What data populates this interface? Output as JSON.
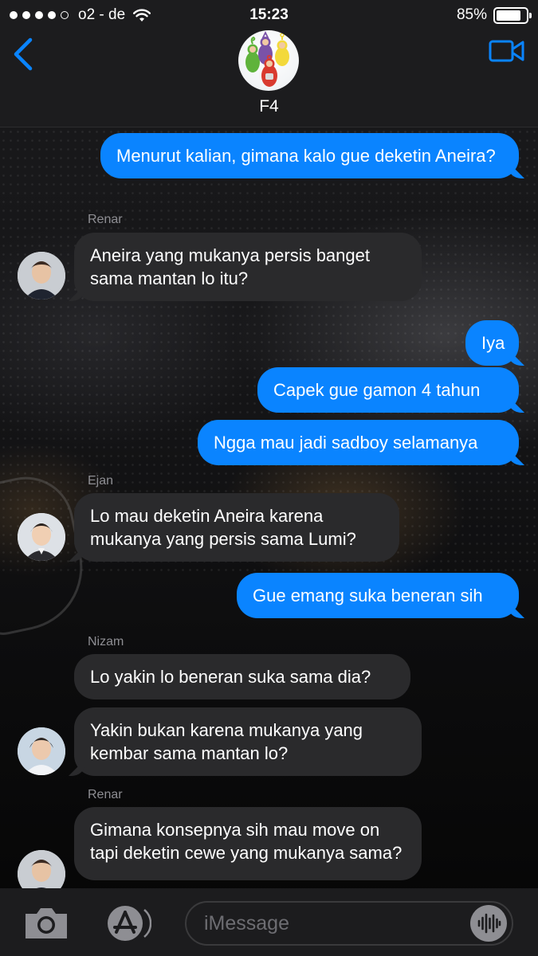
{
  "status_bar": {
    "carrier": "o2 - de",
    "time": "15:23",
    "battery": "85%",
    "battery_level": 0.85,
    "signal_bars_filled": 4,
    "signal_bars_total": 5
  },
  "header": {
    "group_name": "F4",
    "back_icon": "chevron-left-icon",
    "video_icon": "video-camera-icon",
    "accent_color": "#0a84ff"
  },
  "messages": [
    {
      "dir": "out",
      "text": "Menurut kalian, gimana kalo gue deketin Aneira?"
    },
    {
      "dir": "in",
      "sender": "Renar",
      "text": "Aneira yang mukanya persis banget sama mantan lo itu?"
    },
    {
      "dir": "out",
      "text": "Iya"
    },
    {
      "dir": "out",
      "text": "Capek gue gamon 4 tahun"
    },
    {
      "dir": "out",
      "text": "Ngga mau jadi sadboy selamanya"
    },
    {
      "dir": "in",
      "sender": "Ejan",
      "text": "Lo mau deketin Aneira karena mukanya yang persis sama Lumi?"
    },
    {
      "dir": "out",
      "text": "Gue emang suka beneran sih"
    },
    {
      "dir": "in",
      "sender": "Nizam",
      "text": "Lo yakin lo beneran suka sama dia?"
    },
    {
      "dir": "in",
      "text": "Yakin bukan karena mukanya yang kembar sama mantan lo?"
    },
    {
      "dir": "in",
      "sender": "Renar",
      "text": "Gimana konsepnya sih mau move on tapi deketin cewe yang mukanya sama?"
    }
  ],
  "composer": {
    "placeholder": "iMessage",
    "camera_icon": "camera-icon",
    "appstore_icon": "app-store-icon",
    "audio_icon": "audio-waveform-icon"
  },
  "colors": {
    "outgoing_bubble": "#0a84ff",
    "incoming_bubble": "#2a2a2c",
    "bar_background": "#1c1c1e"
  }
}
